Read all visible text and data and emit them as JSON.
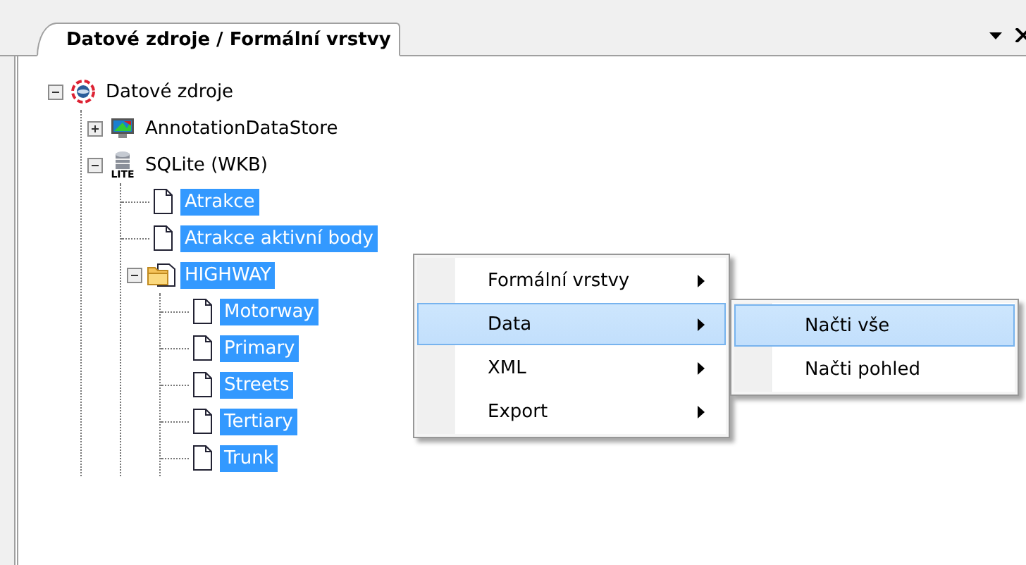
{
  "tab": {
    "title": "Datové zdroje / Formální vrstvy",
    "selected": true
  },
  "tree": [
    {
      "label": "Datové zdroje",
      "kind": "datasource",
      "expanded": true,
      "selected": false,
      "children": [
        {
          "label": "AnnotationDataStore",
          "kind": "monitor",
          "expanded": false,
          "selected": false
        },
        {
          "label": "SQLite (WKB)",
          "kind": "database",
          "icon_label": "LITE",
          "expanded": true,
          "selected": false,
          "children": [
            {
              "label": "Atrakce",
              "kind": "layer",
              "selected": true
            },
            {
              "label": "Atrakce aktivní body",
              "kind": "layer",
              "selected": true
            },
            {
              "label": "HIGHWAY",
              "kind": "folder",
              "expanded": true,
              "selected": true,
              "children": [
                {
                  "label": "Motorway",
                  "kind": "layer",
                  "selected": true
                },
                {
                  "label": "Primary",
                  "kind": "layer",
                  "selected": true
                },
                {
                  "label": "Streets",
                  "kind": "layer",
                  "selected": true
                },
                {
                  "label": "Tertiary",
                  "kind": "layer",
                  "selected": true
                },
                {
                  "label": "Trunk",
                  "kind": "layer",
                  "selected": true
                }
              ]
            }
          ]
        }
      ]
    }
  ],
  "context_menu": [
    {
      "label": "Formální vrstvy",
      "selected": false
    },
    {
      "label": "Data",
      "selected": true
    },
    {
      "label": "XML",
      "selected": false
    },
    {
      "label": "Export",
      "selected": false
    }
  ],
  "submenu": [
    {
      "label": "Načti vše",
      "selected": true
    },
    {
      "label": "Načti pohled",
      "selected": false
    }
  ]
}
